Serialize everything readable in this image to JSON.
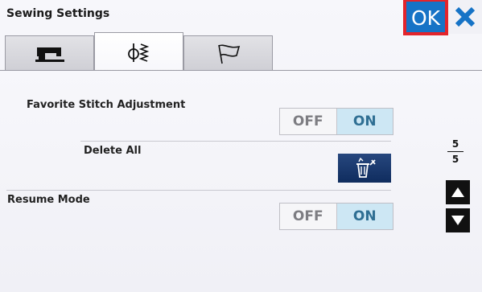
{
  "header": {
    "title": "Sewing Settings",
    "ok_label": "OK",
    "close_icon": "close-icon",
    "accent": "#1673c6",
    "highlight": "#e3242b"
  },
  "tabs": [
    {
      "icon": "sewing-machine-icon",
      "active": false
    },
    {
      "icon": "stitch-settings-icon",
      "active": true
    },
    {
      "icon": "flag-icon",
      "active": false
    }
  ],
  "settings": {
    "favorite_stitch_adjustment": {
      "label": "Favorite Stitch Adjustment",
      "off": "OFF",
      "on": "ON",
      "selected": "ON"
    },
    "delete_all": {
      "label": "Delete All",
      "icon": "delete-all-icon"
    },
    "resume_mode": {
      "label": "Resume Mode",
      "off": "OFF",
      "on": "ON",
      "selected": "ON"
    }
  },
  "pagination": {
    "current": "5",
    "total": "5"
  }
}
